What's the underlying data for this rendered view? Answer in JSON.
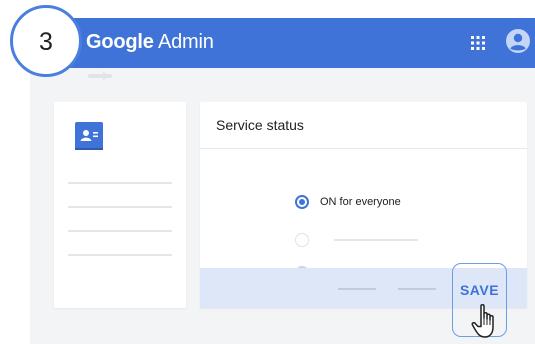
{
  "step": {
    "number": "3"
  },
  "header": {
    "brand_google": "Google",
    "brand_product": "Admin",
    "color": "#3f73d8"
  },
  "icons": {
    "apps": "grid-apps-icon",
    "account": "avatar-icon",
    "admin": "admin-users-icon",
    "cursor": "hand-pointer-icon"
  },
  "service": {
    "title": "Service status",
    "options": [
      {
        "label": "ON for everyone",
        "selected": true
      },
      {
        "label": "",
        "selected": false
      }
    ]
  },
  "actions": {
    "save_label": "SAVE"
  }
}
